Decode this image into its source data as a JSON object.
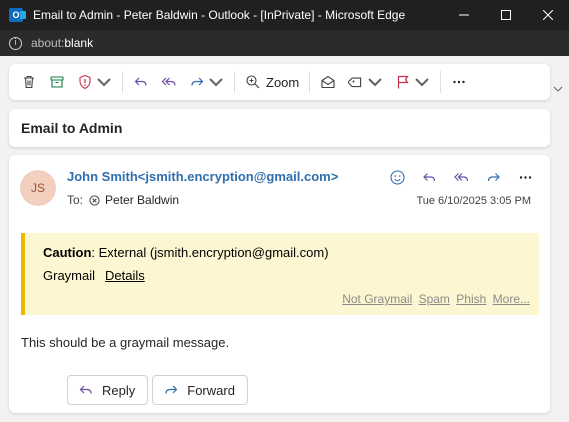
{
  "window": {
    "title": "Email to Admin - Peter Baldwin - Outlook - [InPrivate] - Microsoft Edge",
    "app_icon": "outlook-icon",
    "minimize_icon": "minimize-icon",
    "maximize_icon": "maximize-icon",
    "close_icon": "close-icon"
  },
  "address_bar": {
    "scheme": "about:",
    "page": "blank"
  },
  "toolbar": {
    "zoom_label": "Zoom",
    "icons": [
      "delete-icon",
      "archive-icon",
      "report-icon",
      "reply-icon",
      "reply-all-icon",
      "forward-icon",
      "zoom-icon",
      "mark-read-icon",
      "tag-icon",
      "flag-icon",
      "more-icon"
    ]
  },
  "message": {
    "subject": "Email to Admin",
    "avatar_initials": "JS",
    "sender": "John Smith<jsmith.encryption@gmail.com>",
    "to_label": "To:",
    "recipient": "Peter Baldwin",
    "date": "Tue 6/10/2025 3:05 PM",
    "caution": {
      "label": "Caution",
      "text": ": External (jsmith.encryption@gmail.com)",
      "graymail": "Graymail",
      "details": "Details",
      "links": [
        "Not Graymail",
        "Spam",
        "Phish",
        "More..."
      ]
    },
    "body": "This should be a graymail message.",
    "reply_label": "Reply",
    "forward_label": "Forward"
  },
  "colors": {
    "accent": "#2f6fad",
    "caution_bg": "#fdf6d2",
    "caution_border": "#f2b800",
    "avatar_bg": "#f2cfbf",
    "reply_icon": "#6b4fa8",
    "forward_icon": "#2f6fad",
    "report_icon": "#c4314b",
    "flag_icon": "#c4314b",
    "archive_icon": "#107c41"
  }
}
